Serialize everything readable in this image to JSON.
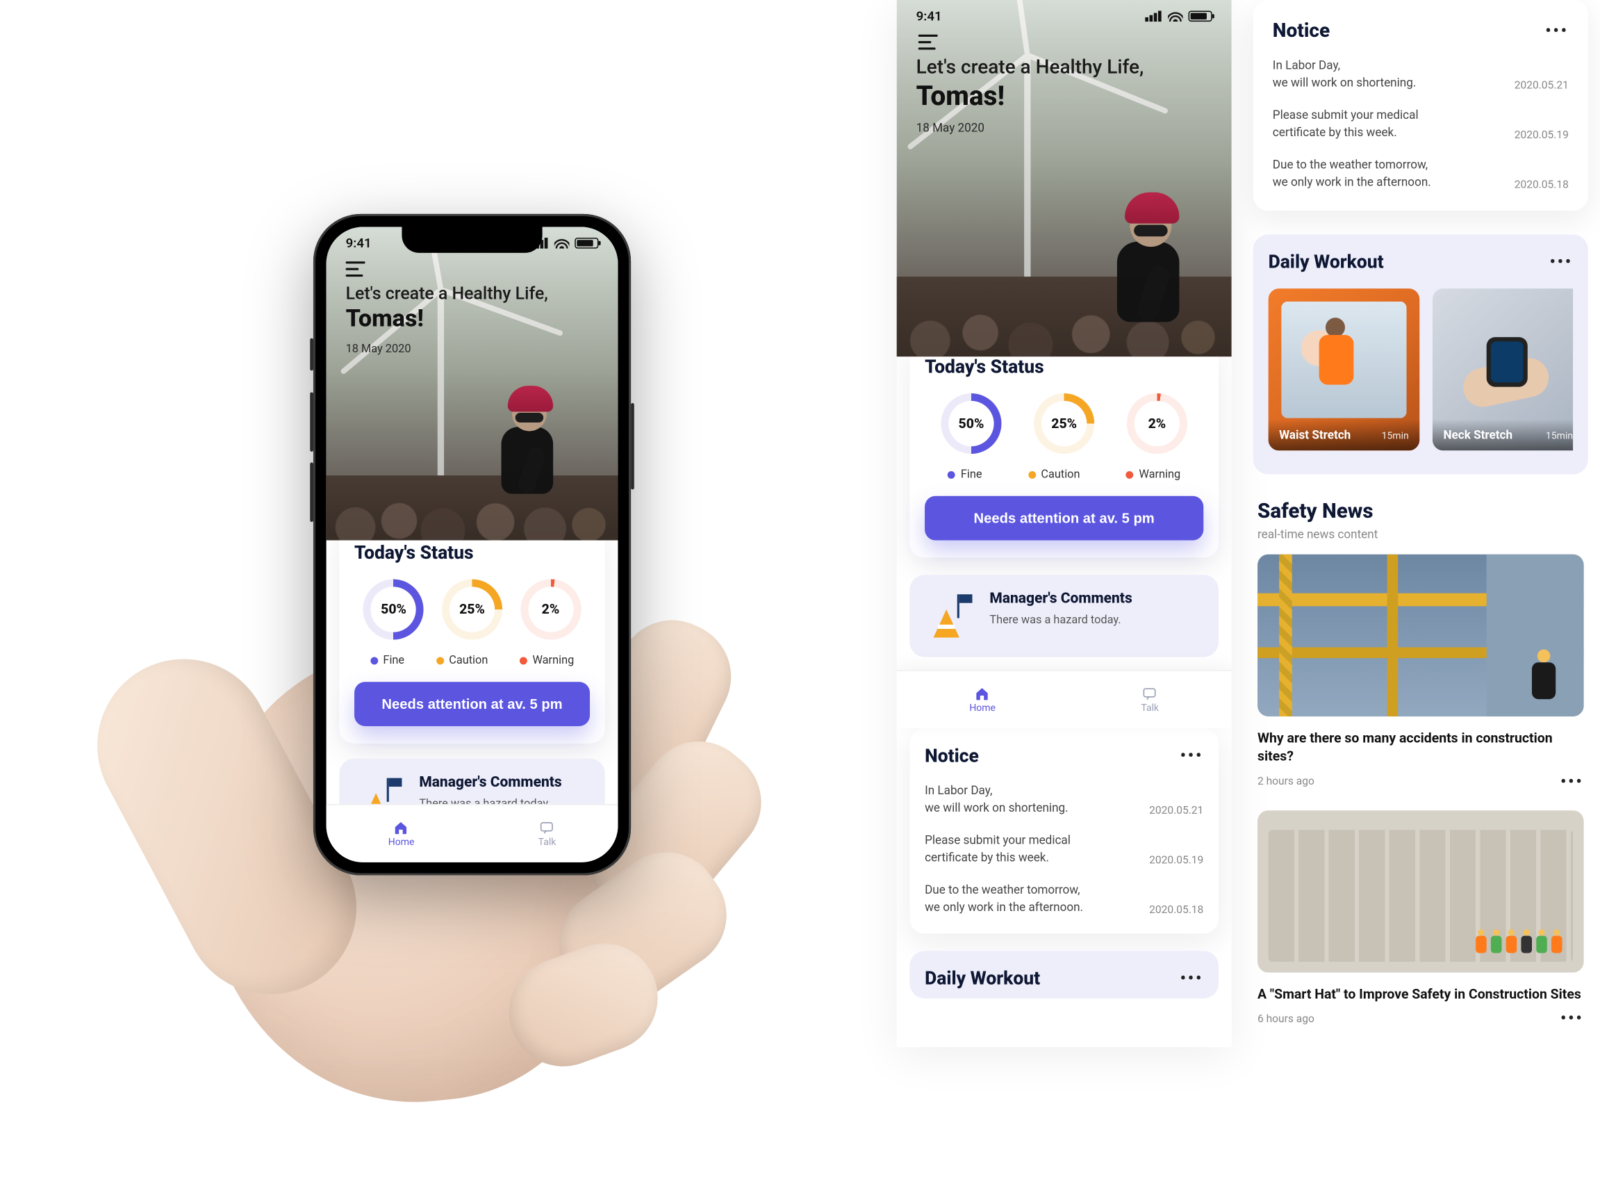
{
  "status_bar": {
    "time": "9:41"
  },
  "greeting": {
    "line": "Let's create a Healthy Life,",
    "name": "Tomas!",
    "date": "18 May 2020"
  },
  "todays_status": {
    "title": "Today's Status",
    "items": [
      {
        "label": "Fine",
        "pct": "50%",
        "value": 50,
        "color": "#5b55e0"
      },
      {
        "label": "Caution",
        "pct": "25%",
        "value": 25,
        "color": "#f5a623"
      },
      {
        "label": "Warning",
        "pct": "2%",
        "value": 2,
        "color": "#f15a3a"
      }
    ],
    "cta": "Needs attention at av. 5 pm"
  },
  "manager": {
    "title": "Manager's Comments",
    "body": "There was a hazard today."
  },
  "nav": {
    "home": "Home",
    "talk": "Talk"
  },
  "notice": {
    "title": "Notice",
    "items": [
      {
        "text_a": "In Labor Day,",
        "text_b": "we will work on shortening.",
        "date": "2020.05.21"
      },
      {
        "text_a": "Please submit your medical",
        "text_b": "certificate by this week.",
        "date": "2020.05.19"
      },
      {
        "text_a": "Due to the weather tomorrow,",
        "text_b": "we only work in the afternoon.",
        "date": "2020.05.18"
      }
    ]
  },
  "workout": {
    "title": "Daily Workout",
    "items": [
      {
        "name": "Waist Stretch",
        "duration": "15min"
      },
      {
        "name": "Neck Stretch",
        "duration": "15min"
      }
    ]
  },
  "safety": {
    "title": "Safety News",
    "subtitle": "real-time news content",
    "items": [
      {
        "headline": "Why are there so many accidents in construction sites?",
        "time": "2 hours ago"
      },
      {
        "headline": "A \"Smart Hat\" to Improve Safety in Construction Sites",
        "time": "6 hours ago"
      }
    ]
  },
  "chart_data": {
    "type": "pie",
    "title": "Today's Status",
    "series": [
      {
        "name": "Fine",
        "values": [
          50
        ],
        "color": "#5b55e0"
      },
      {
        "name": "Caution",
        "values": [
          25
        ],
        "color": "#f5a623"
      },
      {
        "name": "Warning",
        "values": [
          2
        ],
        "color": "#f15a3a"
      }
    ],
    "categories": [
      "Fine",
      "Caution",
      "Warning"
    ],
    "values": [
      50,
      25,
      2
    ],
    "ylim": [
      0,
      100
    ]
  }
}
